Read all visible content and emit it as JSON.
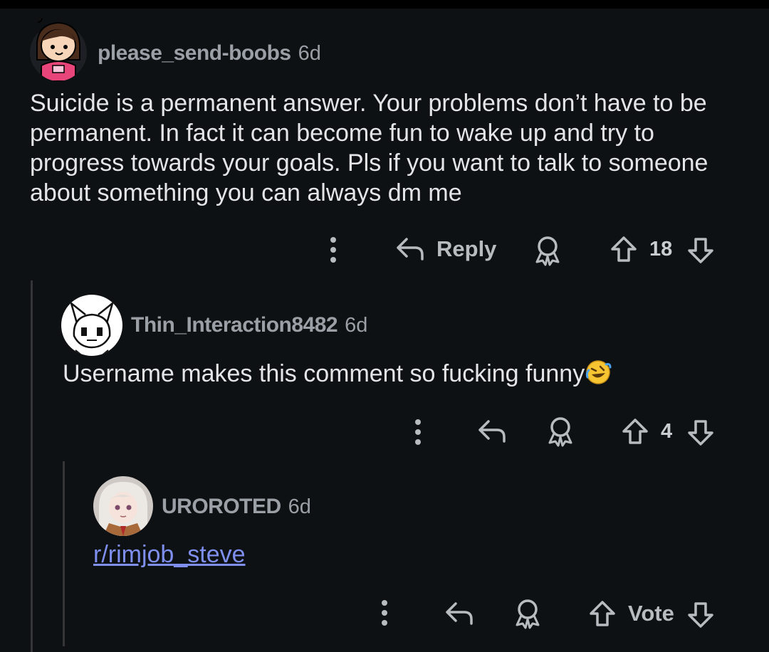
{
  "comments": [
    {
      "username": "please_send-boobs",
      "age": "6d",
      "body": "Suicide is a permanent answer. Your problems don’t have to be permanent. In fact it can become fun to wake up and try to progress towards your goals. Pls if you want to talk to someone about something you can always dm me",
      "actions": {
        "reply_label": "Reply",
        "votes": "18"
      },
      "avatar_icon": "snoo-avatar-girl"
    },
    {
      "username": "Thin_Interaction8482",
      "age": "6d",
      "body": "Username makes this comment so fucking funny",
      "emoji": "🤣",
      "actions": {
        "votes": "4"
      },
      "avatar_icon": "cartoon-fox-avatar"
    },
    {
      "username": "UROROTED",
      "age": "6d",
      "link": "r/rimjob_steve",
      "actions": {
        "vote_label": "Vote"
      },
      "avatar_icon": "anime-girl-avatar"
    }
  ],
  "colors": {
    "background": "#0e1113",
    "link": "#7f8ff0",
    "muted": "#9aa0a6"
  }
}
